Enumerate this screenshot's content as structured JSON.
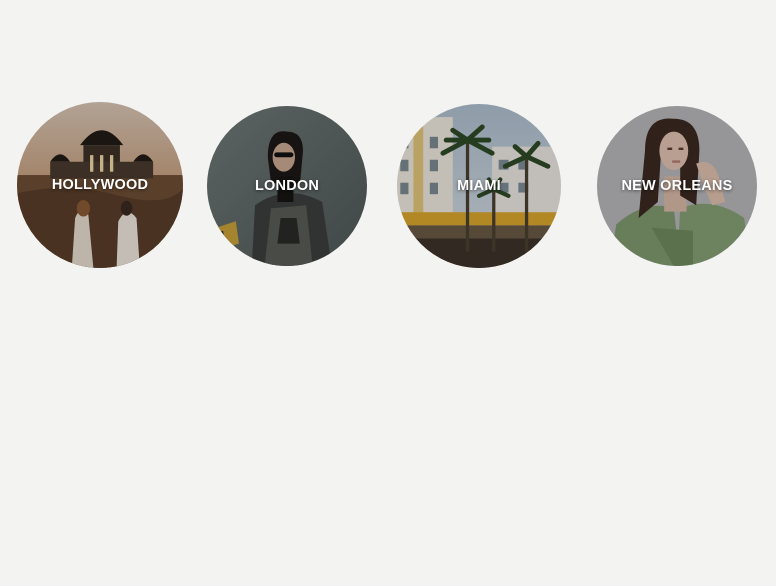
{
  "cities": [
    {
      "name": "HOLLYWOOD",
      "image": "observatory-couple-photo"
    },
    {
      "name": "LONDON",
      "image": "street-fashion-photo"
    },
    {
      "name": "MIAMI",
      "image": "art-deco-palm-street-photo"
    },
    {
      "name": "NEW ORLEANS",
      "image": "green-blazer-portrait-photo"
    }
  ],
  "colors": {
    "background": "#f3f3f1",
    "label": "#ffffff"
  }
}
